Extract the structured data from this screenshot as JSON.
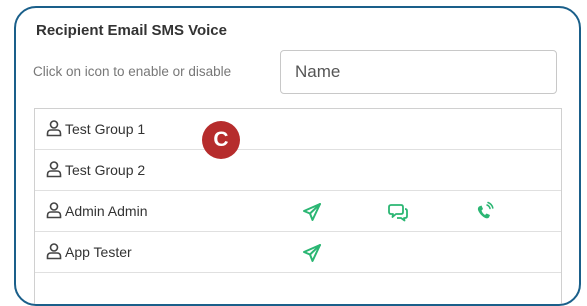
{
  "header": {
    "recipient": "Recipient",
    "email": "Email",
    "sms": "SMS",
    "voice": "Voice"
  },
  "hint": "Click on icon to enable or disable",
  "search": {
    "placeholder": "Name"
  },
  "badge": "C",
  "rows": [
    {
      "label": "Test Group 1",
      "email": false,
      "sms": false,
      "voice": false
    },
    {
      "label": "Test Group 2",
      "email": false,
      "sms": false,
      "voice": false
    },
    {
      "label": "Admin Admin",
      "email": true,
      "sms": true,
      "voice": true
    },
    {
      "label": "App Tester",
      "email": true,
      "sms": false,
      "voice": false
    }
  ],
  "colors": {
    "frame_border": "#1a5f8a",
    "channel_icon": "#2bb673",
    "badge": "#b62c2c"
  },
  "icons": {
    "person": "person-icon",
    "email": "send-icon",
    "sms": "chat-icon",
    "voice": "phone-icon"
  }
}
